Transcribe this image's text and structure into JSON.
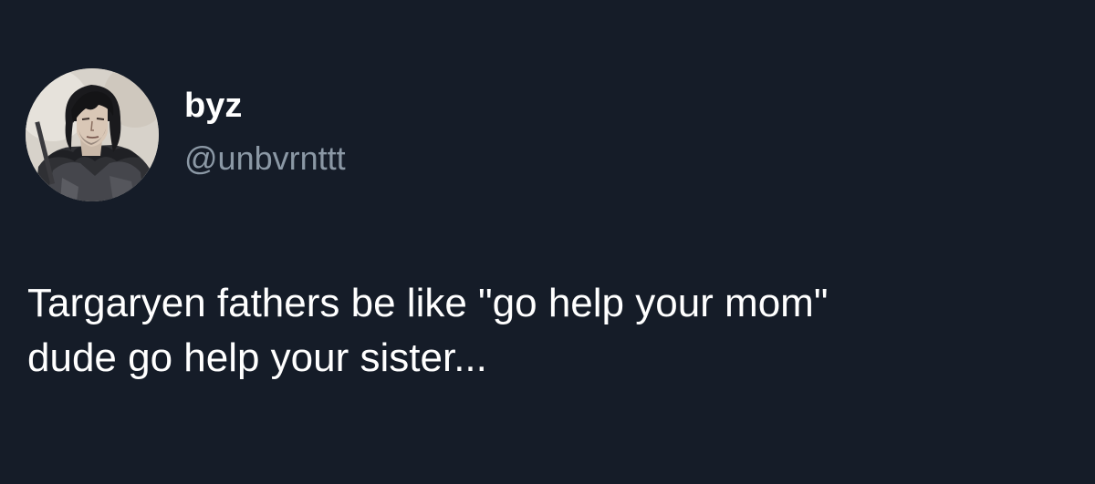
{
  "colors": {
    "background": "#151c28",
    "primary_text": "#ffffff",
    "secondary_text": "#8b98a5"
  },
  "author": {
    "display_name": "byz",
    "handle": "@unbvrnttt",
    "avatar_icon": "avatar-dark-haired-armored-figure-icon"
  },
  "tweet": {
    "lines": [
      "Targaryen fathers be like \"go help your mom\"",
      "dude go help your sister..."
    ]
  }
}
